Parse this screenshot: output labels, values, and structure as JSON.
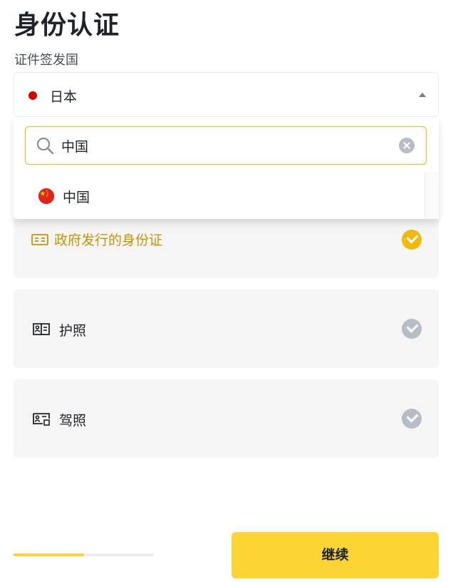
{
  "header": {
    "title": "身份认证"
  },
  "country_field": {
    "label": "证件签发国",
    "selected_value": "日本",
    "flag_color": "#d60000"
  },
  "search": {
    "value": "中国",
    "placeholder": ""
  },
  "results": [
    {
      "label": "中国",
      "icon": "china-flag-icon"
    }
  ],
  "documents": [
    {
      "label": "政府发行的身份证",
      "icon": "id-card-icon",
      "selected": true
    },
    {
      "label": "护照",
      "icon": "passport-icon",
      "selected": false
    },
    {
      "label": "驾照",
      "icon": "drivers-license-icon",
      "selected": false
    }
  ],
  "progress": {
    "fraction": 0.5
  },
  "footer": {
    "continue_label": "继续"
  },
  "colors": {
    "accent": "#fcd535",
    "accent_dark": "#f0b90b",
    "selected_text": "#c99400",
    "unselected_check": "#b7bdc6"
  }
}
